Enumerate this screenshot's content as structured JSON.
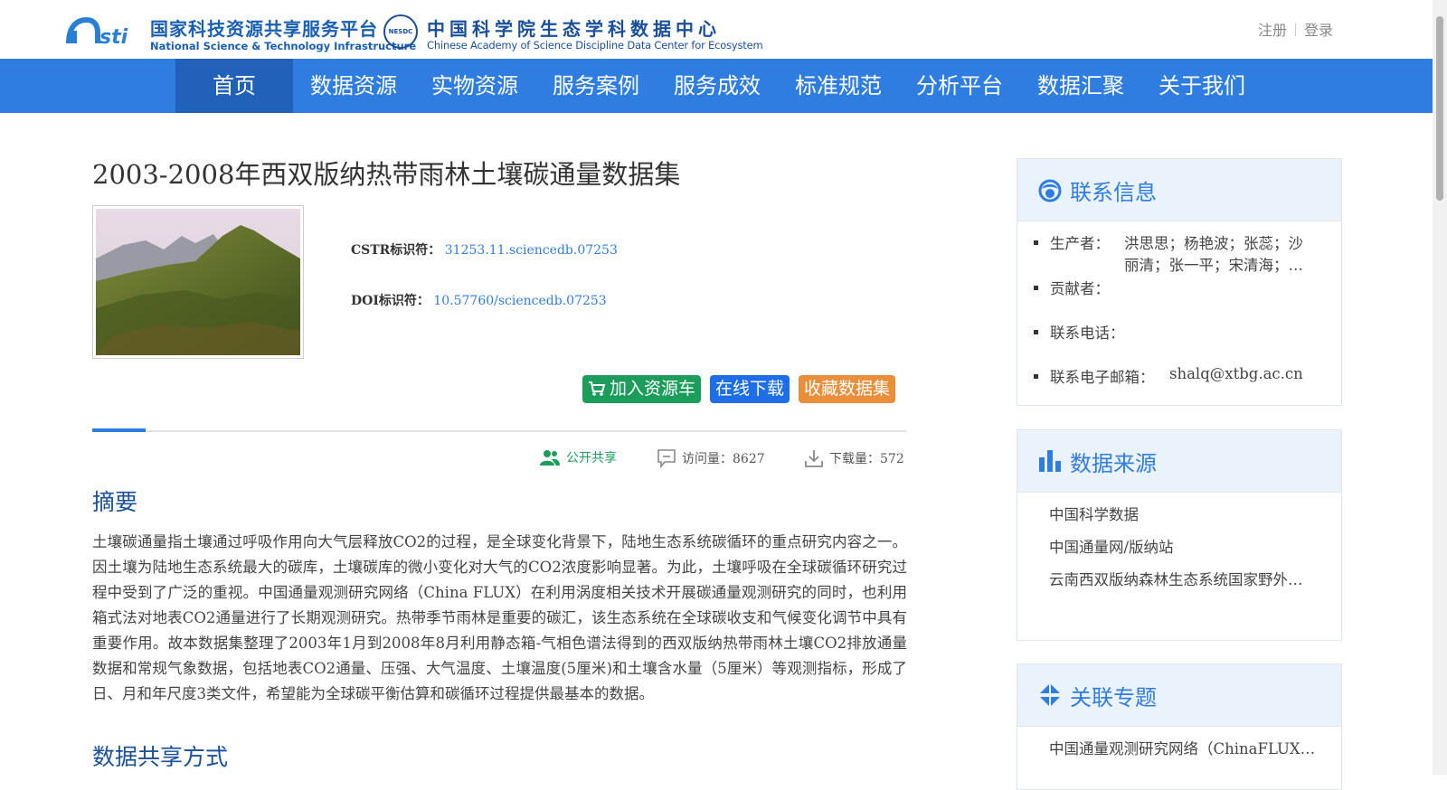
{
  "header": {
    "logo_primary": {
      "cn": "国家科技资源共享服务平台",
      "en": "National Science & Technology Infrastructure",
      "mark": "Nsti"
    },
    "logo_secondary": {
      "badge": "NESDC",
      "cn": "中国科学院生态学科数据中心",
      "en": "Chinese Academy of Science Discipline Data Center for Ecosystem"
    },
    "register": "注册",
    "login": "登录"
  },
  "nav": {
    "items": [
      "首页",
      "数据资源",
      "实物资源",
      "服务案例",
      "服务成效",
      "标准规范",
      "分析平台",
      "数据汇聚",
      "关于我们"
    ],
    "active_index": 0
  },
  "dataset": {
    "title": "2003-2008年西双版纳热带雨林土壤碳通量数据集",
    "cstr_label": "CSTR标识符：",
    "cstr_value": "31253.11.sciencedb.07253",
    "doi_label": "DOI标识符：",
    "doi_value": "10.57760/sciencedb.07253"
  },
  "actions": {
    "add_to_cart": "加入资源车",
    "download": "在线下载",
    "favorite": "收藏数据集"
  },
  "stats": {
    "share": "公开共享",
    "visits": "访问量：8627",
    "downloads": "下载量：572"
  },
  "abstract": {
    "heading": "摘要",
    "text": "土壤碳通量指土壤通过呼吸作用向大气层释放CO2的过程，是全球变化背景下，陆地生态系统碳循环的重点研究内容之一。因土壤为陆地生态系统最大的碳库，土壤碳库的微小变化对大气的CO2浓度影响显著。为此，土壤呼吸在全球碳循环研究过程中受到了广泛的重视。中国通量观测研究网络（China FLUX）在利用涡度相关技术开展碳通量观测研究的同时，也利用箱式法对地表CO2通量进行了长期观测研究。热带季节雨林是重要的碳汇，该生态系统在全球碳收支和气候变化调节中具有重要作用。故本数据集整理了2003年1月到2008年8月利用静态箱-气相色谱法得到的西双版纳热带雨林土壤CO2排放通量数据和常规气象数据，包括地表CO2通量、压强、大气温度、土壤温度(5厘米)和土壤含水量（5厘米）等观测指标，形成了日、月和年尺度3类文件，希望能为全球碳平衡估算和碳循环过程提供最基本的数据。"
  },
  "sharing": {
    "heading": "数据共享方式"
  },
  "sidebar": {
    "contact": {
      "title": "联系信息",
      "producer_label": "生产者：",
      "producer_line1": "洪思思；杨艳波；张蕊；沙",
      "producer_line2": "丽清；张一平；宋清海；…",
      "contributor_label": "贡献者：",
      "phone_label": "联系电话：",
      "email_label": "联系电子邮箱：",
      "email_value": "shalq@xtbg.ac.cn"
    },
    "source": {
      "title": "数据来源",
      "items": [
        "中国科学数据",
        "中国通量网/版纳站",
        "云南西双版纳森林生态系统国家野外…"
      ]
    },
    "topic": {
      "title": "关联专题",
      "items": [
        "中国通量观测研究网络（ChinaFLUX…"
      ]
    }
  },
  "colors": {
    "nav": "#2f7de1",
    "nav_active": "#2261b9",
    "green": "#1d9d5c",
    "blue": "#1e6ee8",
    "orange": "#e98f3c",
    "heading": "#1a4f9c"
  }
}
